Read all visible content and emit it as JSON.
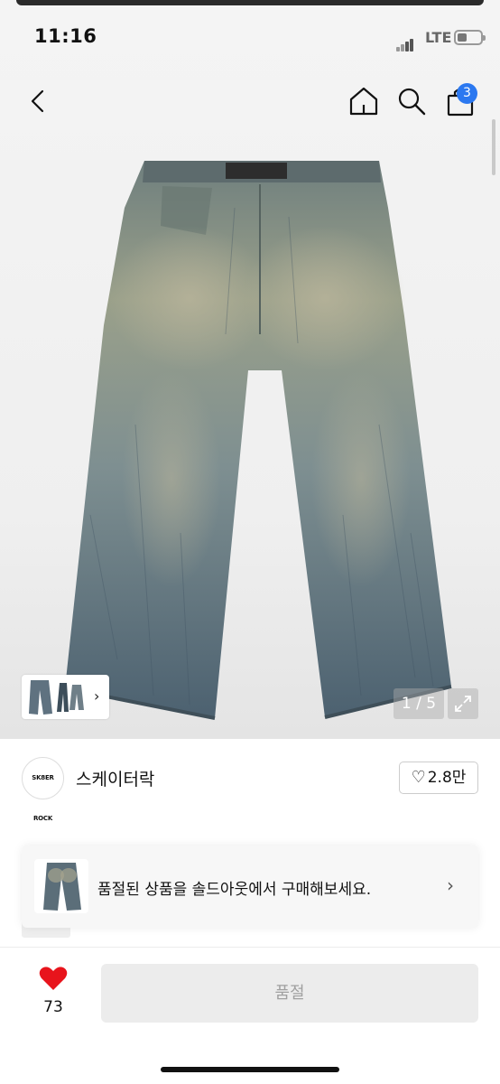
{
  "status_bar": {
    "time": "11:16",
    "network": "LTE"
  },
  "nav": {
    "cart_count": "3",
    "icons": [
      "back-arrow-icon",
      "home-icon",
      "search-icon",
      "shopping-bag-icon"
    ]
  },
  "gallery": {
    "counter": "1 / 5"
  },
  "store": {
    "logo_text": "SK8ER ROCK",
    "name": "스케이터락",
    "follow_count": "2.8만"
  },
  "banner": {
    "text": "품절된 상품을 솔드아웃에서 구매해보세요."
  },
  "bottom_bar": {
    "like_count": "73",
    "soldout_label": "품절"
  },
  "colors": {
    "accent": "#2b78f0",
    "heart": "#e8141c",
    "disabled_button": "#ececec"
  }
}
